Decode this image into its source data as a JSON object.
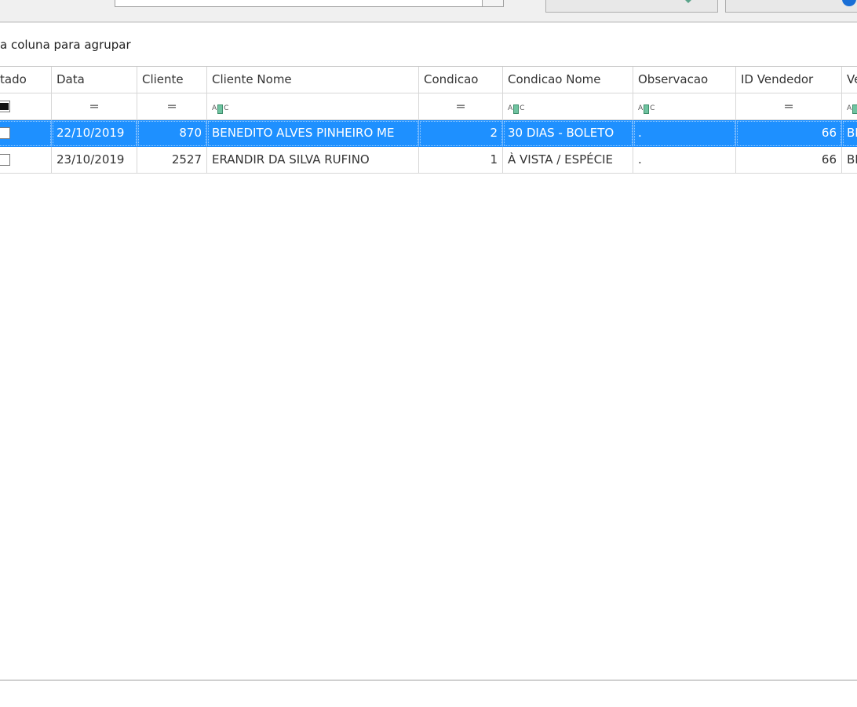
{
  "group_panel": {
    "text": "a coluna para agrupar"
  },
  "columns": [
    {
      "label": "tado"
    },
    {
      "label": "Data"
    },
    {
      "label": "Cliente"
    },
    {
      "label": "Cliente Nome"
    },
    {
      "label": "Condicao"
    },
    {
      "label": "Condicao Nome"
    },
    {
      "label": "Observacao"
    },
    {
      "label": "ID Vendedor"
    },
    {
      "label": "Ve"
    }
  ],
  "filter_row": {
    "numeric_icon": "equals-icon",
    "text_icon": "abc-filter-icon",
    "eq_symbol": "═",
    "abc_left": "A",
    "abc_right": "C"
  },
  "rows": [
    {
      "selected": true,
      "data": "22/10/2019",
      "cliente": "870",
      "cliente_nome": "BENEDITO ALVES PINHEIRO ME",
      "condicao": "2",
      "condicao_nome": "30 DIAS - BOLETO",
      "observacao": ".",
      "id_vendedor": "66",
      "ve": "BE"
    },
    {
      "selected": false,
      "data": "23/10/2019",
      "cliente": "2527",
      "cliente_nome": "ERANDIR DA SILVA RUFINO",
      "condicao": "1",
      "condicao_nome": "À VISTA / ESPÉCIE",
      "observacao": ".",
      "id_vendedor": "66",
      "ve": "BE"
    }
  ],
  "colors": {
    "selection": "#1e90ff",
    "grid_line": "#d7d7d7",
    "toolbar_bg": "#f0f0f0"
  }
}
